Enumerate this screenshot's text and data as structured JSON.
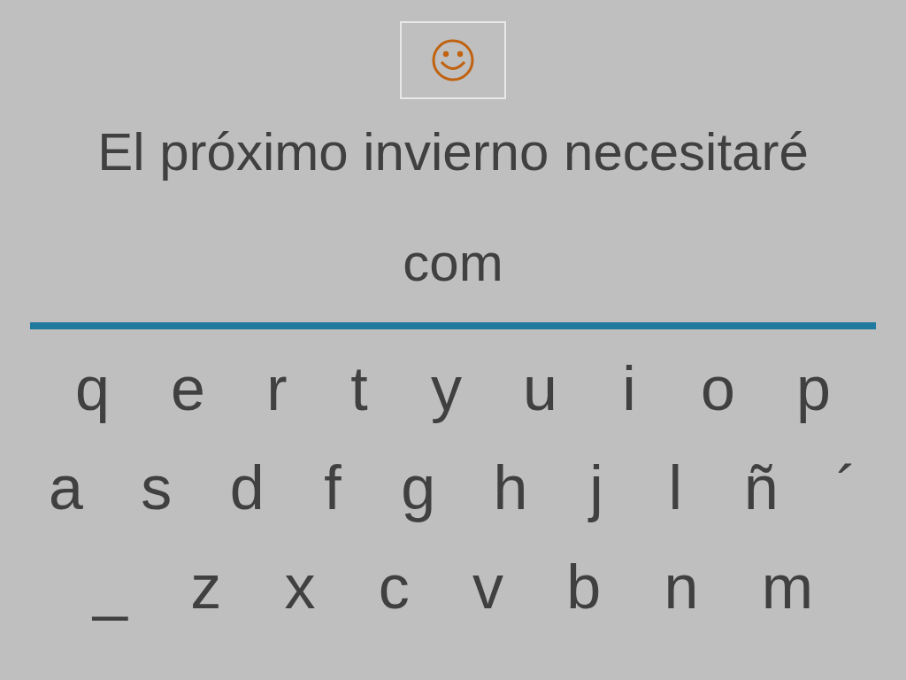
{
  "prompt": "El próximo invierno necesitaré",
  "answer": "com",
  "keyboard": [
    [
      "q",
      "e",
      "r",
      "t",
      "y",
      "u",
      "i",
      "o",
      "p"
    ],
    [
      "a",
      "s",
      "d",
      "f",
      "g",
      "h",
      "j",
      "l",
      "ñ",
      "´"
    ],
    [
      "_",
      "z",
      "x",
      "c",
      "v",
      "b",
      "n",
      "m"
    ]
  ]
}
